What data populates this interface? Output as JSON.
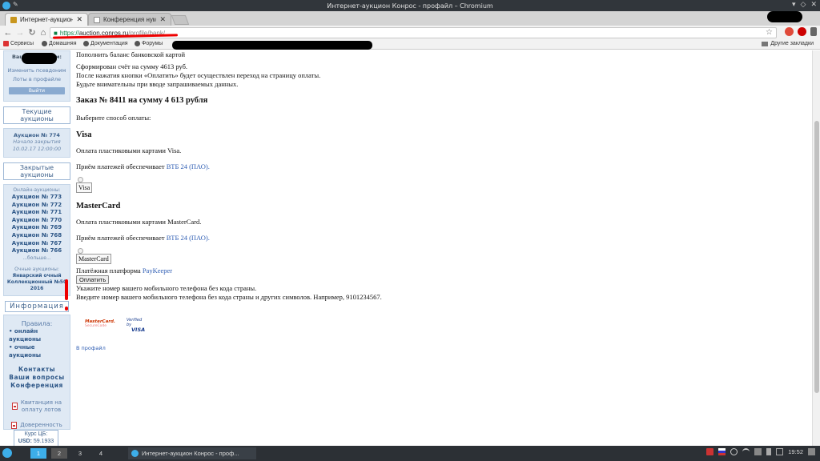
{
  "window": {
    "title": "Интернет-аукцион Конрос - профайл – Chromium"
  },
  "tabs": [
    {
      "label": "Интернет-аукцион Ко",
      "active": true
    },
    {
      "label": "Конференция нумиз",
      "active": false
    }
  ],
  "omnibox": {
    "scheme": "https://",
    "host": "auction.conros.ru",
    "path": "/profile/bank/"
  },
  "bookmarks": {
    "items": [
      "Сервисы",
      "Домашняя",
      "Документация",
      "Форумы"
    ],
    "other": "Другие закладки"
  },
  "sidebar": {
    "greeting": "Ваш псевдоним:",
    "change_nick": "Изменить псевдоним",
    "profile_lots": "Лоты в профайле",
    "logout": "Выйти",
    "current_title": "Текущие аукционы",
    "current_auction": "Аукцион № 774",
    "closing_label": "Начало закрытия",
    "closing_time": "10.02.17 12:00:00",
    "closed_title": "Закрытые аукционы",
    "online_label": "Онлайн-аукционы:",
    "closed_list": [
      "Аукцион № 773",
      "Аукцион № 772",
      "Аукцион № 771",
      "Аукцион № 770",
      "Аукцион № 769",
      "Аукцион № 768",
      "Аукцион № 767",
      "Аукцион № 766"
    ],
    "more": "...больше...",
    "offline_label": "Очные аукционы:",
    "offline_line1": "Январский очный",
    "offline_line2": "Коллекционный №50",
    "offline_line3": "2016",
    "info_title": "Информация",
    "rules_head": "Правила:",
    "rules": [
      "онлайн аукционы",
      "очные аукционы"
    ],
    "contacts": "Контакты",
    "questions": "Ваши вопросы",
    "conference": "Конференция",
    "receipt_line1": "Квитанция на",
    "receipt_line2": "оплату лотов",
    "poa": "Доверенность",
    "rate_label": "Курс ЦБ:",
    "rate_usd_label": "USD:",
    "rate_usd": "59.1933"
  },
  "main": {
    "crumb": "Пополнить баланс банковской картой",
    "line1": "Сформирован счёт на сумму 4613 руб.",
    "line2": "После нажатия кнопки «Оплатить» будет осуществлен переход на страницу оплаты.",
    "line3": "Будьте внимательны при вводе запрашиваемых данных.",
    "order_title": "Заказ № 8411 на сумму 4 613 рубля",
    "choose": "Выберите способ оплаты:",
    "visa_title": "Visa",
    "visa_desc": "Оплата пластиковыми картами Visa.",
    "accept_prefix": "Приём платежей обеспечивает",
    "bank_link": "ВТБ 24 (ПАО).",
    "visa_img_alt": "Visa",
    "mc_title": "MasterCard",
    "mc_desc": "Оплата пластиковыми картами MasterCard.",
    "mc_img_alt": "MasterCard",
    "platform_prefix": "Платёжная платформа",
    "platform_link": "PayKeeper",
    "pay_button": "Оплатить",
    "phone_line1": "Укажите номер вашего мобильного телефона без кода страны.",
    "phone_line2": "Введите номер вашего мобильного телефона без кода страны и других символов. Например, 9101234567.",
    "mc_logo_line1": "MasterCard.",
    "mc_logo_line2": "SecureCode",
    "visa_logo_line1": "Verified by",
    "visa_logo_line2": "VISA",
    "back_link": "В профайл"
  },
  "taskbar": {
    "pages": [
      "1",
      "2",
      "3",
      "4"
    ],
    "task": "Интернет-аукцион Конрос - проф...",
    "clock": "19:52"
  },
  "colors": {
    "accent": "#3daee9",
    "link": "#2e5db3",
    "sidebar_bg": "#dfe9f4",
    "annotation_red": "#e00000"
  }
}
